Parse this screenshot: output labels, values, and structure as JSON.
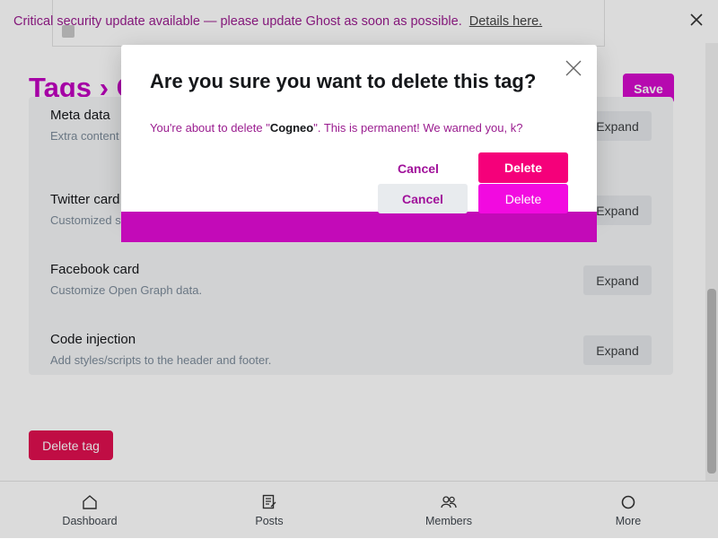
{
  "notice": {
    "text": "Critical security update available — please update Ghost as soon as possible.",
    "link": "Details here.",
    "close_icon": "close-icon"
  },
  "header": {
    "breadcrumb_parent": "Tags",
    "breadcrumb_separator": "›",
    "breadcrumb_current": "C",
    "save_label": "Save"
  },
  "settings": [
    {
      "title": "Meta data",
      "desc": "Extra content for search engines.",
      "button": "Expand"
    },
    {
      "title": "Twitter card",
      "desc": "Customized structured data for Twitter.",
      "button": "Expand"
    },
    {
      "title": "Facebook card",
      "desc": "Customize Open Graph data.",
      "button": "Expand"
    },
    {
      "title": "Code injection",
      "desc": "Add styles/scripts to the header and footer.",
      "button": "Expand"
    }
  ],
  "delete_tag_label": "Delete tag",
  "modal": {
    "title": "Are you sure you want to delete this tag?",
    "body_prefix": "You're about to delete \"",
    "tag_name": "Cogneo",
    "body_suffix": "\". This is permanent! We warned you, k?",
    "cancel_label": "Cancel",
    "delete_label": "Delete"
  },
  "bottom_nav": [
    {
      "label": "Dashboard",
      "icon": "home-icon"
    },
    {
      "label": "Posts",
      "icon": "posts-icon"
    },
    {
      "label": "Members",
      "icon": "members-icon"
    },
    {
      "label": "More",
      "icon": "more-icon"
    }
  ],
  "colors": {
    "accent": "#d40bcc",
    "danger": "#e01050",
    "delete_primary": "#f5007a"
  }
}
